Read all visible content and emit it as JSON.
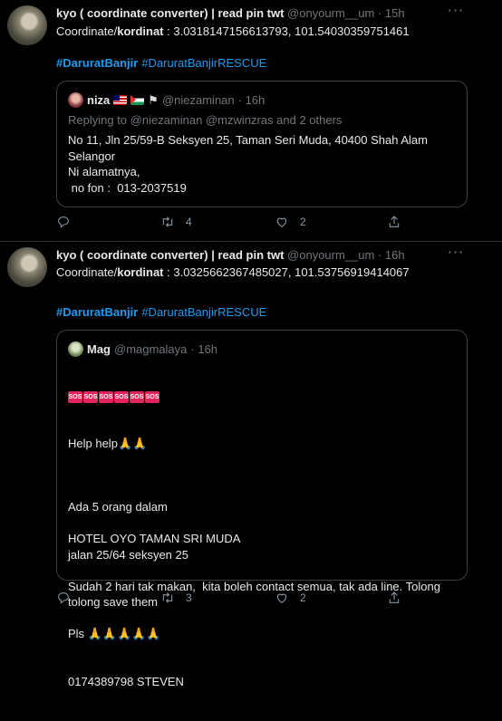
{
  "tweets": [
    {
      "author_name": "kyo ( coordinate converter) | read pin twt",
      "author_handle": "@onyourm__um",
      "time": "· 15h",
      "coord_prefix": "Coordinate/",
      "coord_bold": "kordinat",
      "coord_value": " : 3.0318147156613793, 101.54030359751461",
      "hashtags": [
        "#DaruratBanjir",
        "#DaruratBanjirRESCUE"
      ],
      "quote": {
        "name": "niza",
        "handle": "@niezaminan",
        "time": "· 16h",
        "reply_to": "Replying to @niezaminan @mzwinzras and 2 others",
        "text": "No 11, Jln 25/59-B Seksyen 25, Taman Seri Muda, 40400 Shah Alam\nSelangor\nNi alamatnya,\n no fon :  013-2037519"
      },
      "replies": "",
      "retweets": "4",
      "likes": "2"
    },
    {
      "author_name": "kyo ( coordinate converter) | read pin twt",
      "author_handle": "@onyourm__um",
      "time": "· 16h",
      "coord_prefix": "Coordinate/",
      "coord_bold": "kordinat",
      "coord_value": " : 3.0325662367485027, 101.53756919414067",
      "hashtags": [
        "#DaruratBanjir",
        "#DaruratBanjirRESCUE"
      ],
      "quote": {
        "name": "Mag",
        "handle": "@magmalaya",
        "time": "· 16h",
        "sos": [
          "SOS",
          "SOS",
          "SOS",
          "SOS",
          "SOS",
          "SOS"
        ],
        "text_first": "Help help",
        "text": "\nAda 5 orang dalam\n\nHOTEL OYO TAMAN SRI MUDA\njalan 25/64 seksyen 25\n\nSudah 2 hari tak makan,  kita boleh contact semua, tak ada line. Tolong\ntolong save them\n\nPls ",
        "text_last": "0174389798 STEVEN"
      },
      "replies": "",
      "retweets": "3",
      "likes": "2"
    }
  ],
  "more_icon": "⋅⋅⋅",
  "pray_icon": "🙏",
  "colors": {
    "background": "#000000",
    "link": "#1d9bf0",
    "muted": "#71767b",
    "border": "#2f3336"
  }
}
